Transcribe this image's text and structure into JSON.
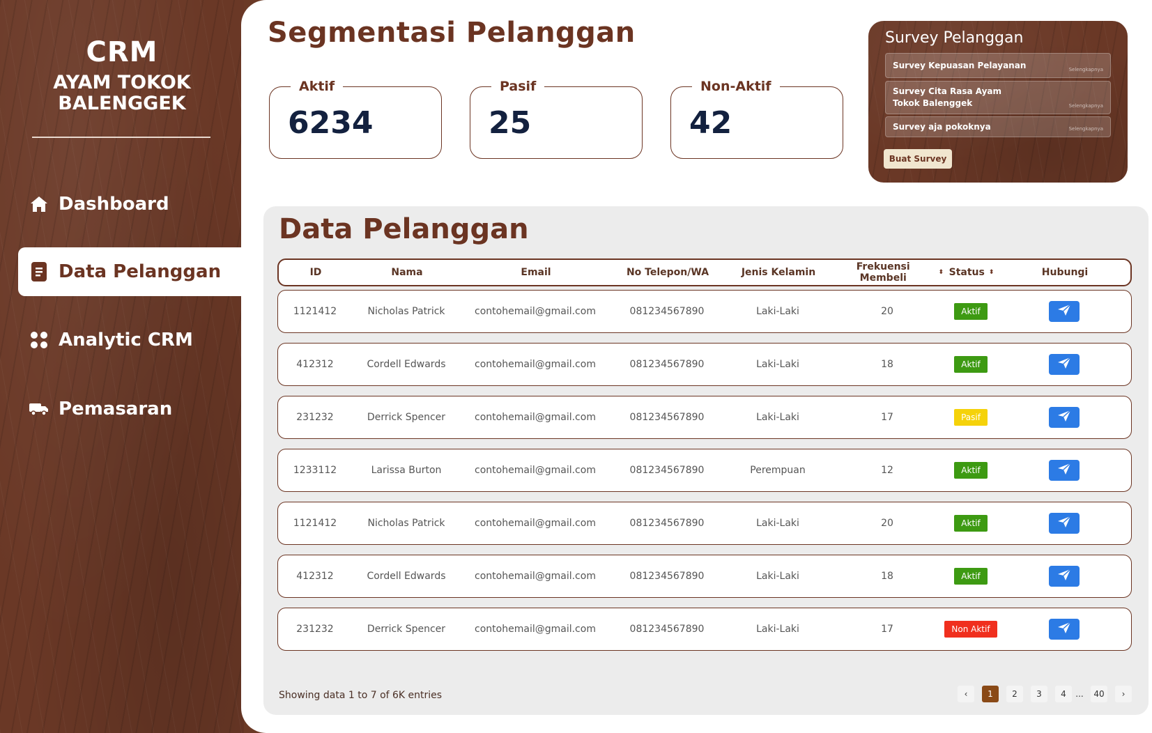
{
  "sidebar": {
    "brand_title": "CRM",
    "brand_subtitle": "AYAM TOKOK BALENGGEK",
    "items": [
      {
        "label": "Dashboard",
        "icon": "home-icon",
        "active": false
      },
      {
        "label": "Data Pelanggan",
        "icon": "document-icon",
        "active": true
      },
      {
        "label": "Analytic CRM",
        "icon": "grid-dots-icon",
        "active": false
      },
      {
        "label": "Pemasaran",
        "icon": "truck-icon",
        "active": false
      }
    ]
  },
  "header": {
    "title": "Segmentasi Pelanggan"
  },
  "stats": [
    {
      "label": "Aktif",
      "value": "6234"
    },
    {
      "label": "Pasif",
      "value": "25"
    },
    {
      "label": "Non-Aktif",
      "value": "42"
    }
  ],
  "survey": {
    "title": "Survey Pelanggan",
    "items": [
      {
        "label": "Survey Kepuasan Pelayanan",
        "more": "Selengkapnya"
      },
      {
        "label": "Survey Cita Rasa Ayam Tokok Balenggek",
        "more": "Selengkapnya"
      },
      {
        "label": "Survey aja pokoknya",
        "more": "Selengkapnya"
      }
    ],
    "button_label": "Buat Survey"
  },
  "data": {
    "title": "Data Pelanggan",
    "columns": [
      "ID",
      "Nama",
      "Email",
      "No Telepon/WA",
      "Jenis Kelamin",
      "Frekuensi Membeli",
      "Status",
      "Hubungi"
    ],
    "rows": [
      {
        "id": "1121412",
        "name": "Nicholas Patrick",
        "email": "contohemail@gmail.com",
        "phone": "081234567890",
        "gender": "Laki-Laki",
        "freq": "20",
        "status": "Aktif"
      },
      {
        "id": "412312",
        "name": "Cordell Edwards",
        "email": "contohemail@gmail.com",
        "phone": "081234567890",
        "gender": "Laki-Laki",
        "freq": "18",
        "status": "Aktif"
      },
      {
        "id": "231232",
        "name": "Derrick Spencer",
        "email": "contohemail@gmail.com",
        "phone": "081234567890",
        "gender": "Laki-Laki",
        "freq": "17",
        "status": "Pasif"
      },
      {
        "id": "1233112",
        "name": "Larissa Burton",
        "email": "contohemail@gmail.com",
        "phone": "081234567890",
        "gender": "Perempuan",
        "freq": "12",
        "status": "Aktif"
      },
      {
        "id": "1121412",
        "name": "Nicholas Patrick",
        "email": "contohemail@gmail.com",
        "phone": "081234567890",
        "gender": "Laki-Laki",
        "freq": "20",
        "status": "Aktif"
      },
      {
        "id": "412312",
        "name": "Cordell Edwards",
        "email": "contohemail@gmail.com",
        "phone": "081234567890",
        "gender": "Laki-Laki",
        "freq": "18",
        "status": "Aktif"
      },
      {
        "id": "231232",
        "name": "Derrick Spencer",
        "email": "contohemail@gmail.com",
        "phone": "081234567890",
        "gender": "Laki-Laki",
        "freq": "17",
        "status": "Non Aktif"
      }
    ],
    "footer_text": "Showing data 1 to 7 of  6K entries",
    "pagination": {
      "prev": "‹",
      "pages": [
        "1",
        "2",
        "3",
        "4"
      ],
      "ellipsis": "...",
      "last": "40",
      "next": "›",
      "current": "1"
    }
  },
  "colors": {
    "brown": "#6b3422",
    "aktif": "#3d9a12",
    "pasif": "#f5d20a",
    "non_aktif": "#f02f1e",
    "send": "#2c7be5"
  }
}
